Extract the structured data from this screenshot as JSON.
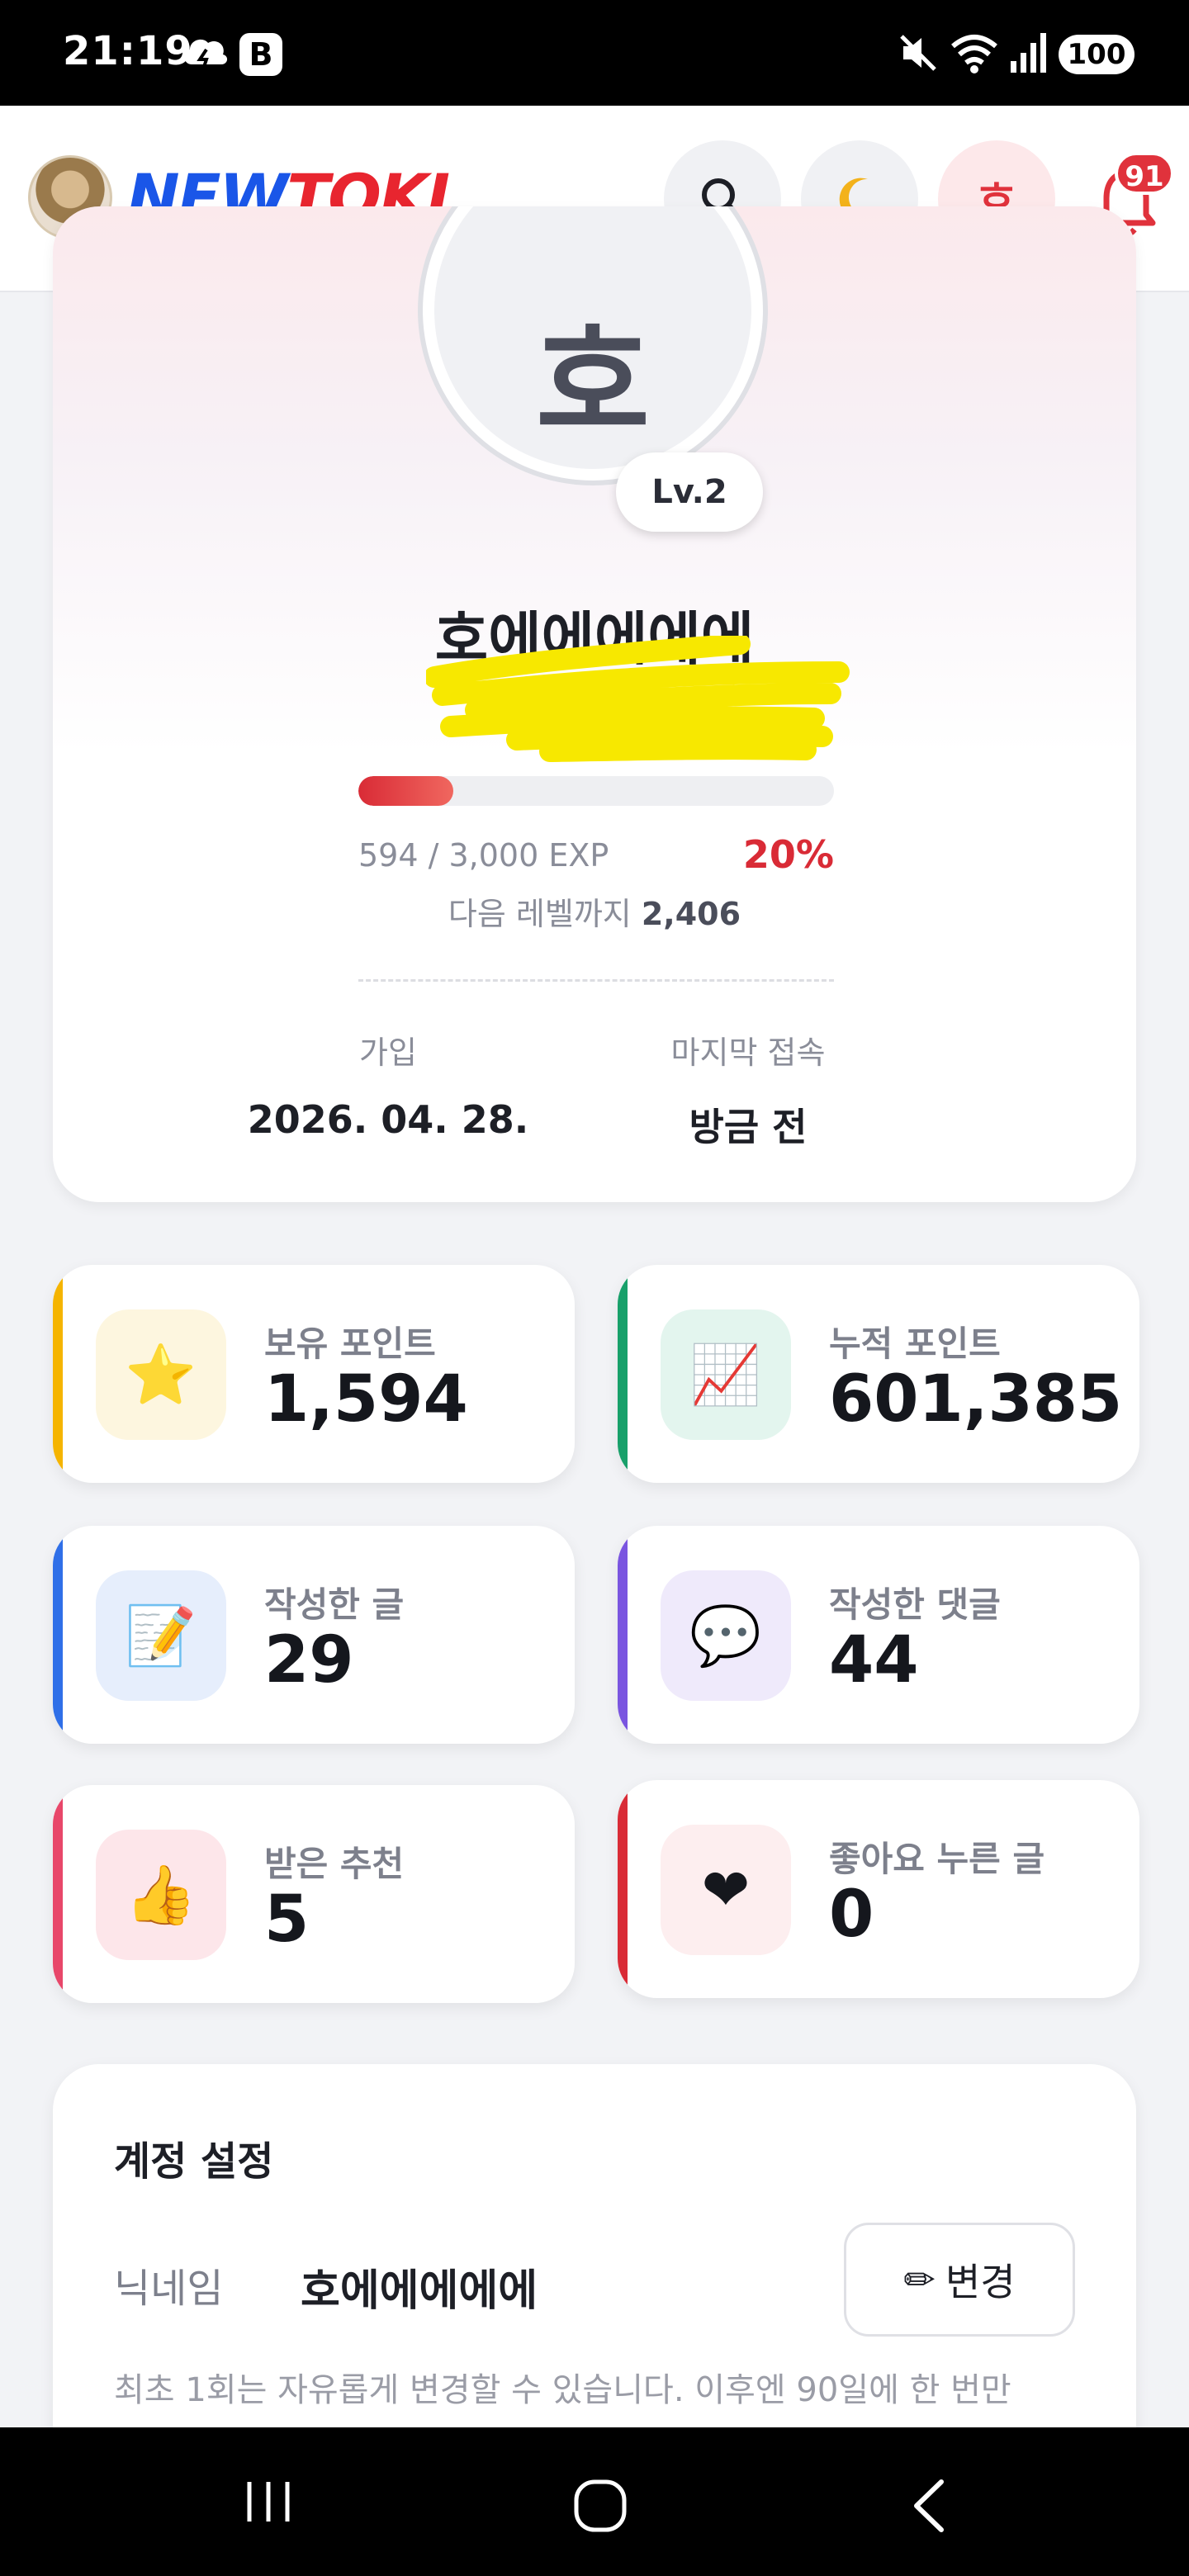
{
  "status_bar": {
    "time": "21:19",
    "b_label": "B",
    "battery": "100"
  },
  "header": {
    "logo_part1": "NEW",
    "logo_part2": "TOKI",
    "profile_button": "호",
    "notification_count": "91"
  },
  "profile": {
    "avatar_initial": "호",
    "level": "Lv.2",
    "nickname": "호에에에에에",
    "exp_fraction": 0.2,
    "exp_text": "594 / 3,000 EXP",
    "exp_percent": "20%",
    "next_level_label": "다음 레벨까지",
    "next_level_value": "2,406",
    "join_label": "가입",
    "join_date": "2026. 04. 28.",
    "last_login_label": "마지막 접속",
    "last_login_value": "방금 전"
  },
  "stats": [
    {
      "label": "보유 포인트",
      "value": "1,594",
      "icon": "⭐",
      "icon_name": "star-icon",
      "accent": "#f5b400",
      "bg": "#fdf6df"
    },
    {
      "label": "누적 포인트",
      "value": "601,385",
      "icon": "📈",
      "icon_name": "chart-up-icon",
      "accent": "#18a06a",
      "bg": "#e3f5ee"
    },
    {
      "label": "작성한 글",
      "value": "29",
      "icon": "📝",
      "icon_name": "memo-icon",
      "accent": "#2f6fe8",
      "bg": "#e6eefc"
    },
    {
      "label": "작성한 댓글",
      "value": "44",
      "icon": "💬",
      "icon_name": "speech-bubble-icon",
      "accent": "#7a55e0",
      "bg": "#efeafb"
    },
    {
      "label": "받은 추천",
      "value": "5",
      "icon": "👍",
      "icon_name": "thumbs-up-icon",
      "accent": "#e8476a",
      "bg": "#fde6ea"
    },
    {
      "label": "좋아요 누른 글",
      "value": "0",
      "icon": "❤",
      "icon_name": "heart-icon",
      "accent": "#d92b36",
      "bg": "#fdeeef"
    }
  ],
  "account": {
    "title": "계정 설정",
    "nickname_label": "닉네임",
    "nickname_value": "호에에에에에",
    "change_icon": "✏",
    "change_button": "변경",
    "note": "최초 1회는 자유롭게 변경할 수 있습니다. 이후엔 90일에 한 번만"
  }
}
